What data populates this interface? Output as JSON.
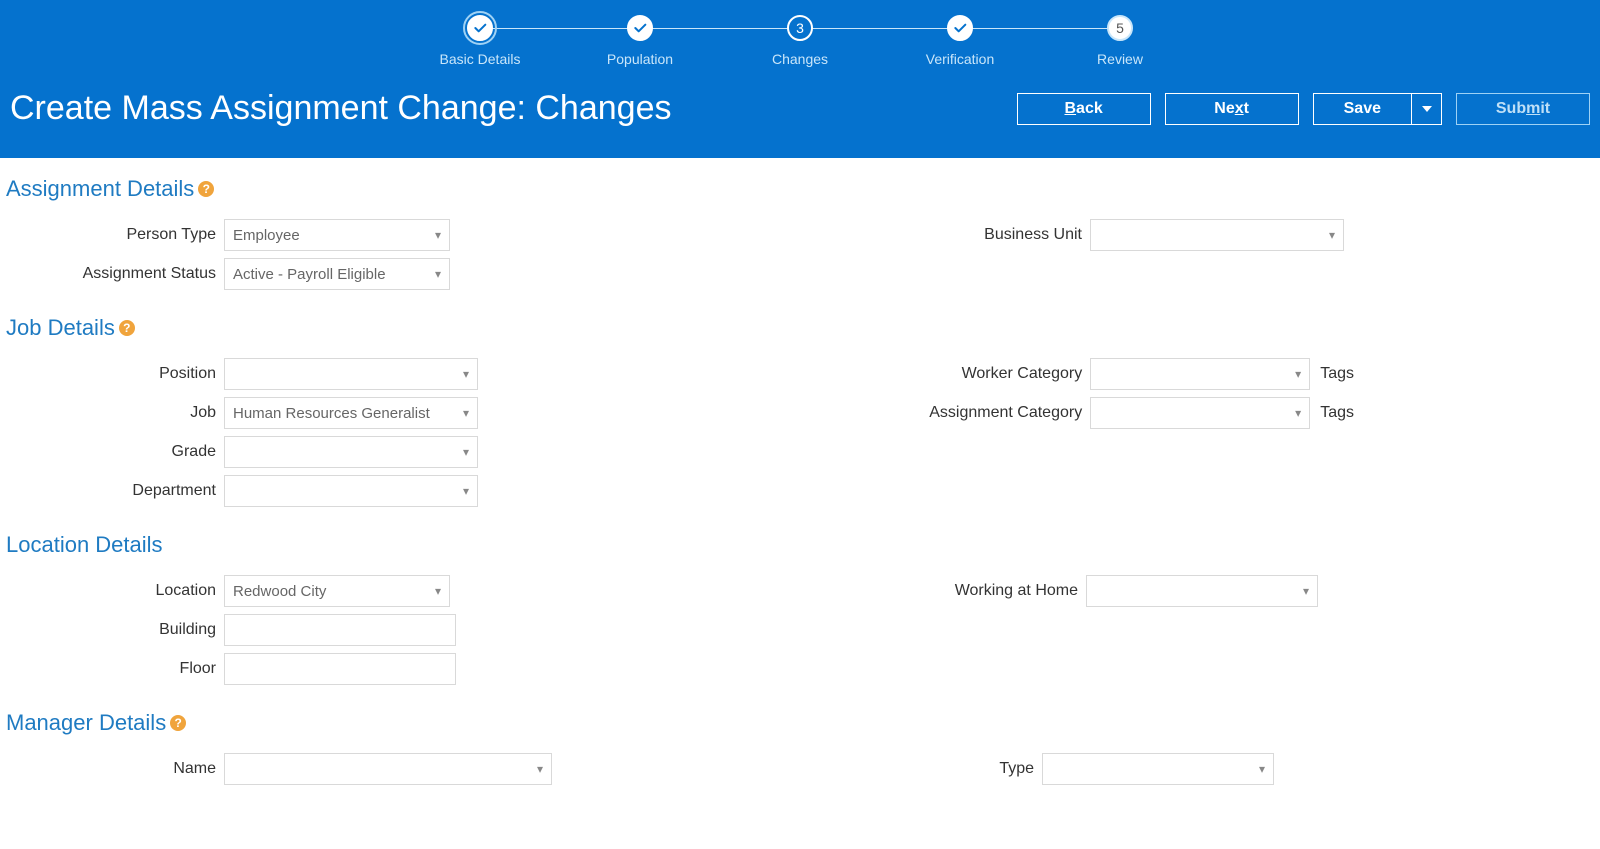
{
  "header": {
    "page_title": "Create Mass Assignment Change: Changes",
    "steps": [
      {
        "label": "Basic Details",
        "status": "complete"
      },
      {
        "label": "Population",
        "status": "complete"
      },
      {
        "label": "Changes",
        "status": "current",
        "number": "3"
      },
      {
        "label": "Verification",
        "status": "complete"
      },
      {
        "label": "Review",
        "status": "todo",
        "number": "5"
      }
    ],
    "buttons": {
      "back": "Back",
      "next": "Next",
      "save": "Save",
      "submit": "Submit"
    }
  },
  "sections": {
    "assignment_details": {
      "title": "Assignment Details",
      "has_help": true,
      "left": [
        {
          "label": "Person Type",
          "value": "Employee",
          "type": "select",
          "size": "sm"
        },
        {
          "label": "Assignment Status",
          "value": "Active - Payroll Eligible",
          "type": "select",
          "size": "sm"
        }
      ],
      "right": [
        {
          "label": "Business Unit",
          "value": "",
          "type": "select",
          "size": "md"
        }
      ]
    },
    "job_details": {
      "title": "Job Details",
      "has_help": true,
      "left": [
        {
          "label": "Position",
          "value": "",
          "type": "select",
          "size": "md"
        },
        {
          "label": "Job",
          "value": "Human Resources Generalist",
          "type": "select",
          "size": "md"
        },
        {
          "label": "Grade",
          "value": "",
          "type": "select",
          "size": "md"
        },
        {
          "label": "Department",
          "value": "",
          "type": "select",
          "size": "md"
        }
      ],
      "right": [
        {
          "label": "Worker Category",
          "value": "",
          "type": "select",
          "size": "sm_r",
          "suffix": "Tags"
        },
        {
          "label": "Assignment Category",
          "value": "",
          "type": "select",
          "size": "sm_r",
          "suffix": "Tags"
        }
      ]
    },
    "location_details": {
      "title": "Location Details",
      "has_help": false,
      "left": [
        {
          "label": "Location",
          "value": "Redwood City",
          "type": "select",
          "size": "sm"
        },
        {
          "label": "Building",
          "value": "",
          "type": "text",
          "size": "input_md"
        },
        {
          "label": "Floor",
          "value": "",
          "type": "text",
          "size": "input_md"
        }
      ],
      "right": [
        {
          "label": "Working at Home",
          "value": "",
          "type": "select",
          "size": "sm_r2"
        }
      ]
    },
    "manager_details": {
      "title": "Manager Details",
      "has_help": true,
      "left": [
        {
          "label": "Name",
          "value": "",
          "type": "select",
          "size": "lg"
        }
      ],
      "right": [
        {
          "label": "Type",
          "value": "",
          "type": "select",
          "size": "sm_r3"
        }
      ]
    }
  }
}
